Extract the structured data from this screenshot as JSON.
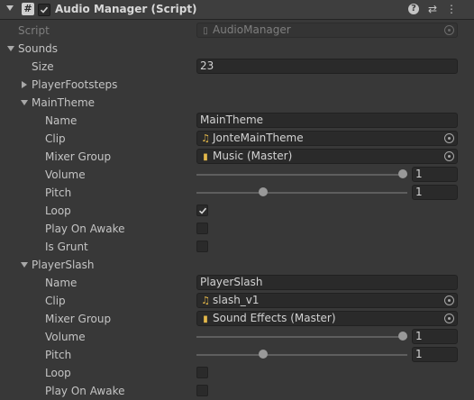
{
  "component": {
    "title": "Audio Manager (Script)",
    "script_icon_glyph": "#",
    "help_glyph": "?",
    "preset_glyph": "⇄",
    "menu_glyph": "⋮"
  },
  "script_row": {
    "label": "Script",
    "value": "AudioManager"
  },
  "sounds": {
    "label": "Sounds",
    "size_label": "Size",
    "size_value": "23",
    "elements": [
      {
        "name": "PlayerFootsteps",
        "expanded": false
      },
      {
        "name": "MainTheme",
        "expanded": true,
        "name_label": "Name",
        "name_value": "MainTheme",
        "clip_label": "Clip",
        "clip_value": "JonteMainTheme",
        "mixer_label": "Mixer Group",
        "mixer_value": "Music (Master)",
        "volume_label": "Volume",
        "volume_value": "1",
        "volume_fraction": 1.0,
        "pitch_label": "Pitch",
        "pitch_value": "1",
        "pitch_fraction": 0.31,
        "loop_label": "Loop",
        "loop_checked": true,
        "play_on_awake_label": "Play On Awake",
        "play_on_awake_checked": false,
        "is_grunt_label": "Is Grunt",
        "is_grunt_checked": false
      },
      {
        "name": "PlayerSlash",
        "expanded": true,
        "name_label": "Name",
        "name_value": "PlayerSlash",
        "clip_label": "Clip",
        "clip_value": "slash_v1",
        "mixer_label": "Mixer Group",
        "mixer_value": "Sound Effects (Master)",
        "volume_label": "Volume",
        "volume_value": "1",
        "volume_fraction": 1.0,
        "pitch_label": "Pitch",
        "pitch_value": "1",
        "pitch_fraction": 0.31,
        "loop_label": "Loop",
        "loop_checked": false,
        "play_on_awake_label": "Play On Awake",
        "play_on_awake_checked": false
      }
    ]
  },
  "icons": {
    "audio_clip": "♫",
    "mixer_group": "▮",
    "script_asset": "▯"
  },
  "colors": {
    "background": "#383838",
    "header": "#3e3e3e",
    "field": "#2a2a2a",
    "text": "#c4c4c4",
    "asset_icon": "#e4b84a"
  }
}
